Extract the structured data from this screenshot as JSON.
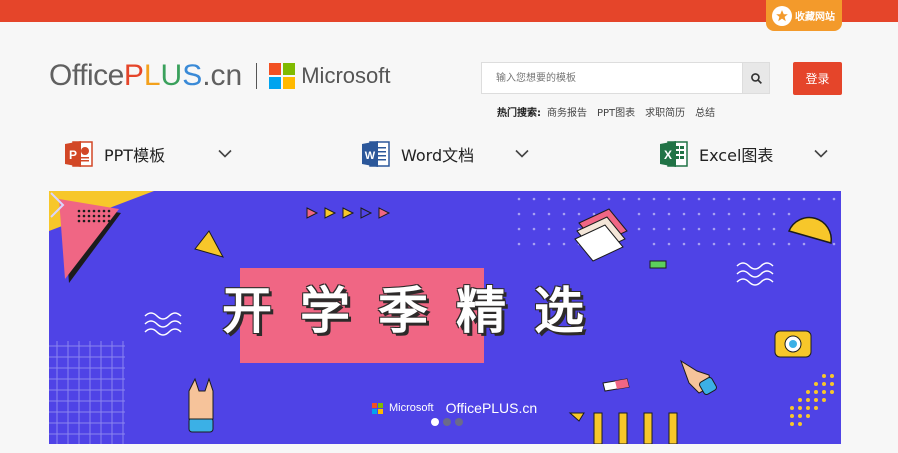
{
  "topbar": {
    "fav_label": "收藏网站",
    "fav_icon": "star-icon",
    "color": "#e5452a",
    "fav_color": "#f39a2b"
  },
  "logo": {
    "office": "Office",
    "p": "P",
    "l": "L",
    "u": "U",
    "s": "S",
    "cn": ".cn",
    "microsoft": "Microsoft"
  },
  "search": {
    "placeholder": "输入您想要的模板",
    "icon": "search-icon"
  },
  "login_label": "登录",
  "hot": {
    "label": "热门搜索:",
    "items": [
      "商务报告",
      "PPT图表",
      "求职简历",
      "总结"
    ]
  },
  "nav": [
    {
      "label": "PPT模板",
      "icon": "powerpoint-icon",
      "color": "#d24726"
    },
    {
      "label": "Word文档",
      "icon": "word-icon",
      "color": "#2b579a"
    },
    {
      "label": "Excel图表",
      "icon": "excel-icon",
      "color": "#217346"
    }
  ],
  "banner": {
    "title": "开学季精选",
    "logo_ms": "Microsoft",
    "logo_op": "OfficePLUS.cn",
    "background": "#4f43e6",
    "active_slide": 1,
    "slide_count": 3
  }
}
